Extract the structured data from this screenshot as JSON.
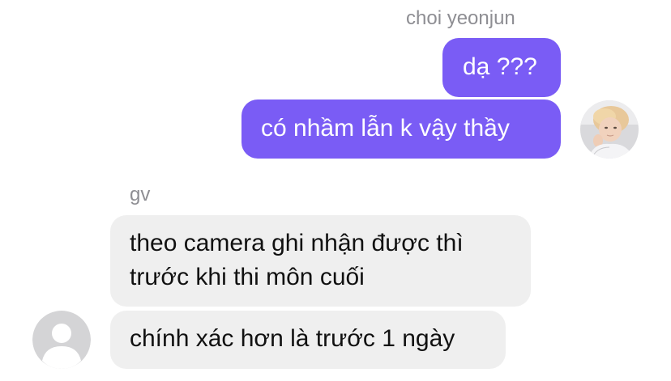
{
  "conversation": {
    "outgoing": {
      "sender": "choi yeonjun",
      "messages": [
        {
          "text": "dạ ???"
        },
        {
          "text": "có nhầm lẫn k vậy thầy"
        }
      ]
    },
    "incoming": {
      "sender": "gv",
      "messages": [
        {
          "lines": [
            "theo camera ghi nhận được thì",
            "trước khi thi môn cuối"
          ]
        },
        {
          "text": "chính xác hơn là trước 1 ngày"
        }
      ]
    }
  },
  "colors": {
    "outgoing_bubble": "#7a5cf5",
    "incoming_bubble": "#efefef",
    "sender_name": "#8e8e93"
  },
  "icons": {
    "outgoing_avatar": "user-photo-avatar",
    "incoming_avatar": "default-person-avatar-icon"
  }
}
